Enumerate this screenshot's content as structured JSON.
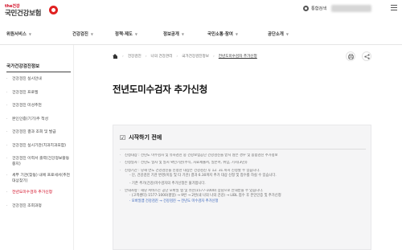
{
  "header": {
    "logo_brand": "the건강",
    "logo_name": "국민건강보험",
    "login_label": "통합검색"
  },
  "nav": {
    "items": [
      "위원서비스",
      "건강검진",
      "정책·제도",
      "정보공개",
      "국민소통·참여",
      "공단소개"
    ]
  },
  "sidebar": {
    "title": "국가건강검진정보",
    "items": [
      "건강검진 실시안내",
      "건강검진 프로필",
      "건강검진 미성추천",
      "본인인증(기기)주 적성",
      "건강검진 결과 조회 및 발급",
      "건강검진 실시기관(치과치과포함)",
      "건강검진 이력서 출력(건강정보활동 중지)",
      "세부 기관(찾동) 내에 프로세서(추천대상찾기)",
      "전년도미수검자 추가신청",
      "건강검진 조회과정"
    ],
    "active_index": 8
  },
  "breadcrumb": [
    "건강검진",
    "나의 건강관리",
    "국가건강검진정보",
    "전년도미수검자 추가신청"
  ],
  "tools": {
    "print_icon": "printer-icon",
    "share_icon": "share-icon"
  },
  "page": {
    "title": "전년도미수검자 추가신청"
  },
  "notice": {
    "heading": "시작하기 전에",
    "rows": [
      "신청대상 : 전년도 미수검자 및 유사검진 중 건강보험공단 건강검진을 받지 않은 경우 및 종합검진 추가정보",
      "신청일자 : 전년도 일자 및 일시 확인기준(주식, 자료제출서, 일본어, 위임, 기지(3년))",
      "신청기간 : 당해 연도 건강검진을 신청한 대상은 건강검진 후 12. 31.까지 신청할 수 있습니다.",
      "- 단, 건강검진 기관 변경(이동 및 타 기관) 결과 6.30까지 추가 대상 신청 및 접수를 하실 수 있습니다.",
      "- 기존 추가(건강)미수검자의 추가신청은 불가합니다.",
      "안내사항 : 해당 서비스는 공단 모바일 앱 및 유선(1577-1000) 상담으로 안내받을 수 있습니다.",
      "· (고객센터) 1577-1000(평일) → 9번 → 2번(내 나의 나의 건강) → LIBL 접수 후 본인인증 및 추가신청"
    ],
    "link_row": "· 모바일앱 건강검진 → 건강검진 → 전년도 미수검자 추가신청"
  }
}
